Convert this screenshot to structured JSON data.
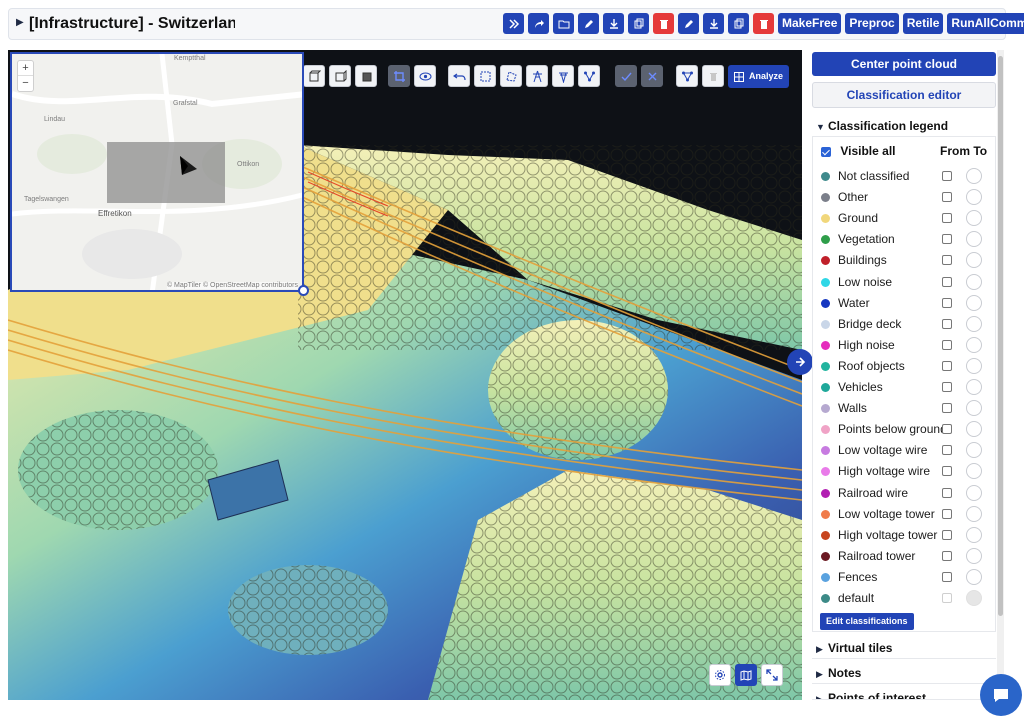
{
  "header": {
    "title": "[Infrastructure] - Switzerland",
    "top_icons": [
      "measure-icon",
      "share-icon",
      "folder-icon",
      "pencil-icon",
      "download-icon",
      "copy-icon",
      "delete-icon",
      "pencil-icon",
      "download-icon",
      "copy-icon",
      "delete-icon"
    ],
    "buttons": [
      "MakeFree",
      "Preproc",
      "Retile",
      "RunAllCommands"
    ]
  },
  "viewer": {
    "analyze_label": "Analyze"
  },
  "minimap": {
    "labels": {
      "kemptthal": "Kemptthal",
      "grafstal": "Grafstal",
      "lindau": "Lindau",
      "ottikon": "Ottikon",
      "tagelswangen": "Tagelswangen",
      "effretikon": "Effretikon"
    },
    "zoom_in": "+",
    "zoom_out": "−",
    "attribution": "© MapTiler © OpenStreetMap contributors"
  },
  "panel": {
    "center_button": "Center point cloud",
    "classification_editor": "Classification editor",
    "legend_title": "Classification legend",
    "visible_all": "Visible all",
    "from_to": "From To",
    "edit_classifications": "Edit classifications",
    "virtual_tiles": "Virtual tiles",
    "notes": "Notes",
    "points_of_interest": "Points of interest",
    "classes": [
      {
        "label": "Not classified",
        "color": "#3f8a8c"
      },
      {
        "label": "Other",
        "color": "#7b7f8a"
      },
      {
        "label": "Ground",
        "color": "#f1d77b"
      },
      {
        "label": "Vegetation",
        "color": "#2f9e4a"
      },
      {
        "label": "Buildings",
        "color": "#c0202a"
      },
      {
        "label": "Low noise",
        "color": "#2fd7e6"
      },
      {
        "label": "Water",
        "color": "#1637c0"
      },
      {
        "label": "Bridge deck",
        "color": "#c9d6e8"
      },
      {
        "label": "High noise",
        "color": "#e52dbd"
      },
      {
        "label": "Roof objects",
        "color": "#22b49f"
      },
      {
        "label": "Vehicles",
        "color": "#1fa89a"
      },
      {
        "label": "Walls",
        "color": "#b6a9d0"
      },
      {
        "label": "Points below ground",
        "color": "#f0a3c6"
      },
      {
        "label": "Low voltage wire",
        "color": "#c77be0"
      },
      {
        "label": "High voltage wire",
        "color": "#e97be9"
      },
      {
        "label": "Railroad wire",
        "color": "#b21fb2"
      },
      {
        "label": "Low voltage tower",
        "color": "#f07c4b"
      },
      {
        "label": "High voltage tower",
        "color": "#c7451f"
      },
      {
        "label": "Railroad tower",
        "color": "#6b1a23"
      },
      {
        "label": "Fences",
        "color": "#5aa2df"
      },
      {
        "label": "default",
        "color": "#3c8a87"
      }
    ]
  }
}
